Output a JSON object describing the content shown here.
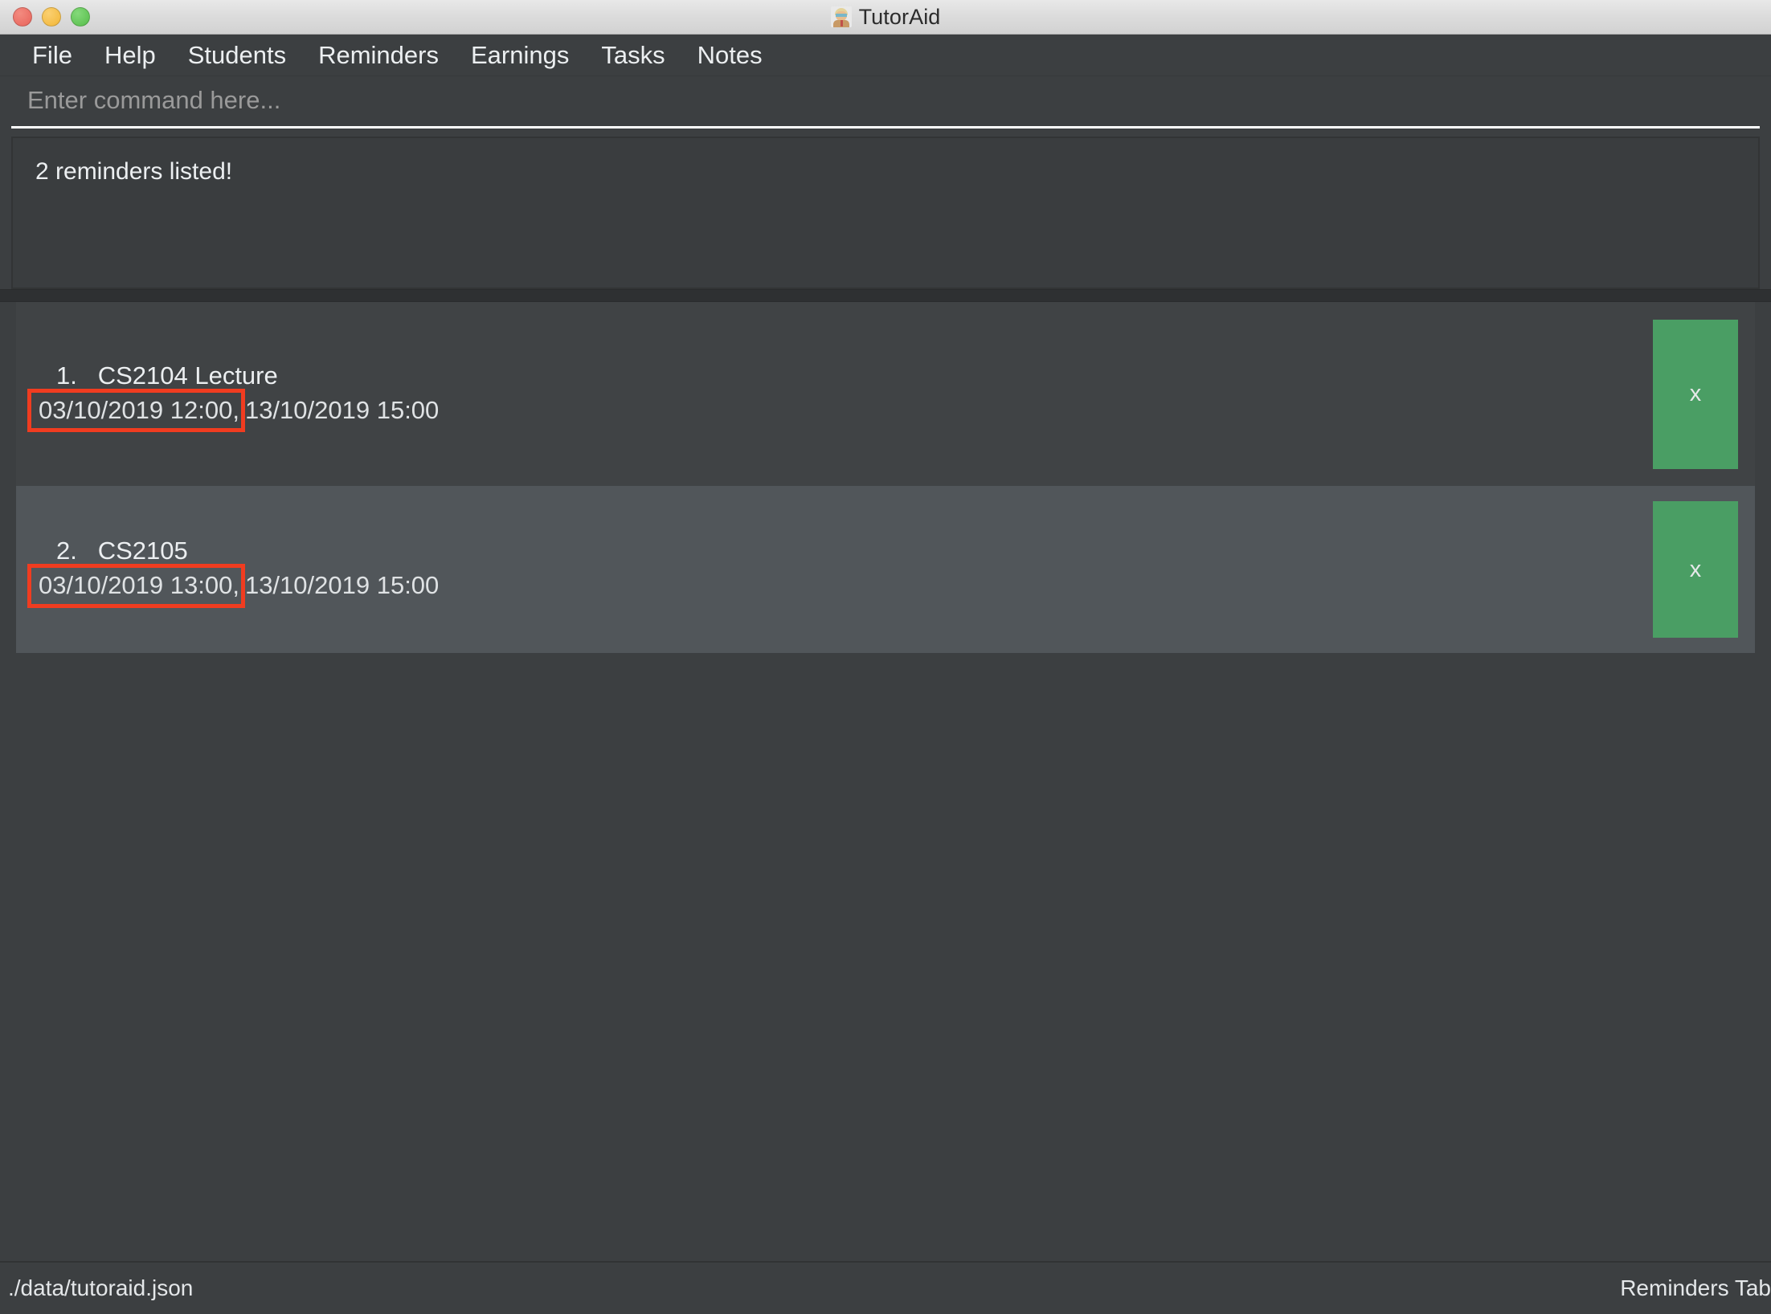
{
  "window": {
    "title": "TutorAid",
    "app_icon": "tutor-avatar-icon",
    "traffic_lights": {
      "close": "close-window-button",
      "minimize": "minimize-window-button",
      "zoom": "zoom-window-button",
      "close_color": "#ec6b5e",
      "minimize_color": "#f5bf4f",
      "zoom_color": "#61c555"
    }
  },
  "menubar": {
    "items": [
      {
        "label": "File"
      },
      {
        "label": "Help"
      },
      {
        "label": "Students"
      },
      {
        "label": "Reminders"
      },
      {
        "label": "Earnings"
      },
      {
        "label": "Tasks"
      },
      {
        "label": "Notes"
      }
    ]
  },
  "command": {
    "value": "",
    "placeholder": "Enter command here..."
  },
  "result": {
    "message": "2 reminders listed!"
  },
  "reminders": {
    "items": [
      {
        "index": "1.",
        "name": "CS2104 Lecture",
        "start_datetime": "03/10/2019 12:00,",
        "end_datetime": "13/10/2019 15:00",
        "delete_label": "x",
        "highlighted": true
      },
      {
        "index": "2.",
        "name": "CS2105",
        "start_datetime": "03/10/2019 13:00,",
        "end_datetime": "13/10/2019 15:00",
        "delete_label": "x",
        "highlighted": true
      }
    ],
    "highlight_color": "#f03c20",
    "action_button_color": "#4a9e64"
  },
  "statusbar": {
    "file_path": "./data/tutoraid.json",
    "tab_name": "Reminders Tab"
  }
}
